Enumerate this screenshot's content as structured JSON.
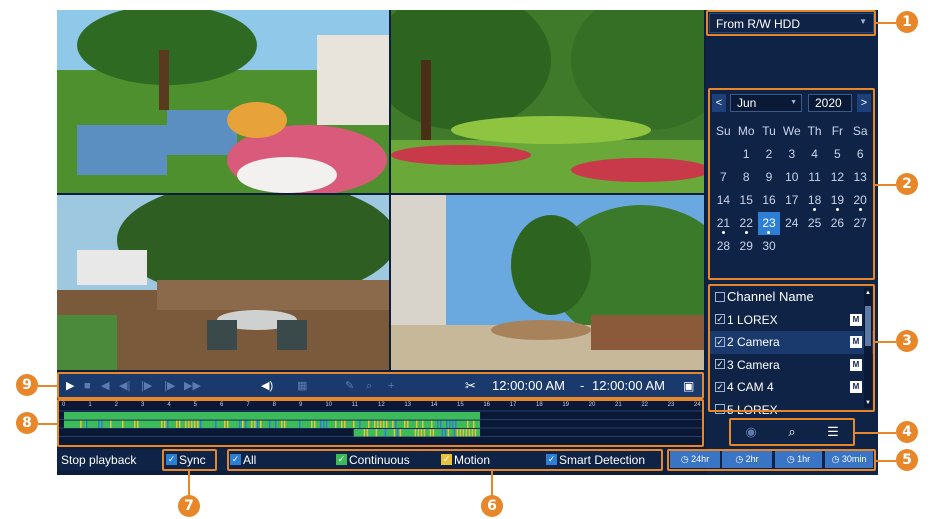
{
  "source_dropdown": {
    "value": "From R/W HDD"
  },
  "calendar": {
    "prev": "<",
    "next": ">",
    "month": "Jun",
    "year": "2020",
    "weekdays": [
      "Su",
      "Mo",
      "Tu",
      "We",
      "Th",
      "Fr",
      "Sa"
    ],
    "weeks": [
      [
        "",
        "1",
        "2",
        "3",
        "4",
        "5",
        "6"
      ],
      [
        "7",
        "8",
        "9",
        "10",
        "11",
        "12",
        "13"
      ],
      [
        "14",
        "15",
        "16",
        "17",
        "18",
        "19",
        "20"
      ],
      [
        "21",
        "22",
        "23",
        "24",
        "25",
        "26",
        "27"
      ],
      [
        "28",
        "29",
        "30",
        "",
        "",
        "",
        ""
      ]
    ],
    "selected_day": "23",
    "days_with_recordings": [
      "18",
      "19",
      "20",
      "21",
      "22",
      "23"
    ]
  },
  "channels": {
    "header": "Channel Name",
    "items": [
      {
        "label": "1 LOREX",
        "checked": true,
        "badge": "M"
      },
      {
        "label": "2 Camera",
        "checked": true,
        "badge": "M"
      },
      {
        "label": "3 Camera",
        "checked": true,
        "badge": "M"
      },
      {
        "label": "4 CAM 4",
        "checked": true,
        "badge": "M"
      },
      {
        "label": "5 LOREX",
        "checked": false,
        "badge": ""
      }
    ]
  },
  "range_buttons": [
    "24hr",
    "2hr",
    "1hr",
    "30min"
  ],
  "playback": {
    "start_time": "12:00:00 AM",
    "separator": "-",
    "end_time": "12:00:00 AM"
  },
  "timeline": {
    "hours": [
      "0",
      "1",
      "2",
      "3",
      "4",
      "5",
      "6",
      "7",
      "8",
      "9",
      "10",
      "11",
      "12",
      "13",
      "14",
      "15",
      "16",
      "17",
      "18",
      "19",
      "20",
      "21",
      "22",
      "23",
      "24"
    ],
    "recorded_until_hour": 15.8
  },
  "bottom_bar": {
    "stop_playback": "Stop playback",
    "sync": "Sync",
    "all": "All",
    "continuous": "Continuous",
    "motion": "Motion",
    "smart_detection": "Smart Detection"
  },
  "callouts": [
    "1",
    "2",
    "3",
    "4",
    "5",
    "6",
    "7",
    "8",
    "9"
  ],
  "colors": {
    "accent": "#e8862a",
    "panel": "#0f2347",
    "continuous": "#3dbb5a",
    "motion": "#e8c23a",
    "smart": "#2d7fd6"
  }
}
